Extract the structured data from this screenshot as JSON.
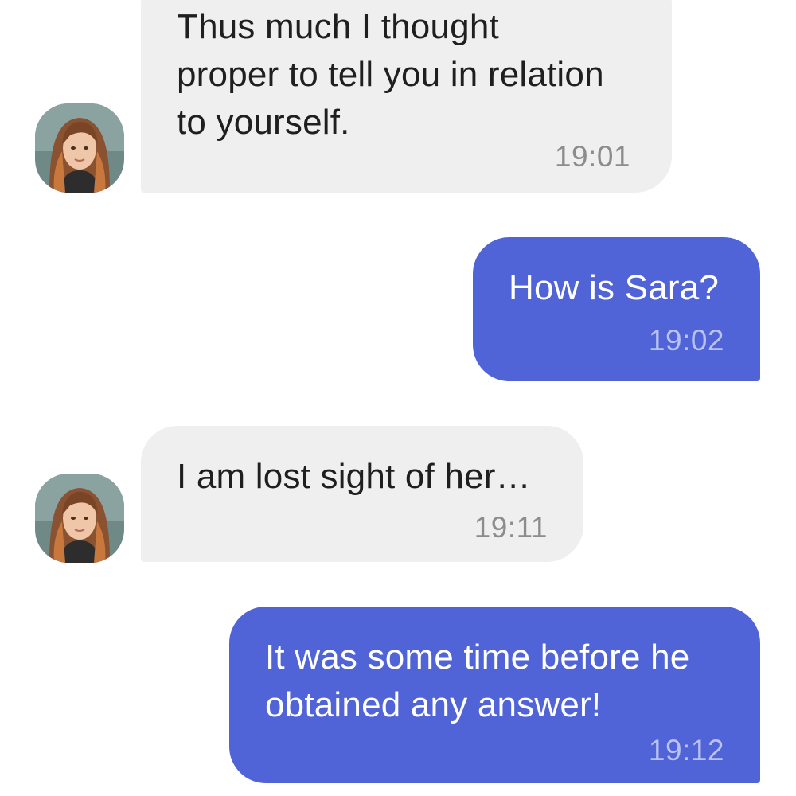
{
  "messages": [
    {
      "direction": "incoming",
      "text": "Thus much I thought\nproper to tell you in relation\nto yourself.",
      "time": "19:01",
      "avatar": "woman-portrait-avatar"
    },
    {
      "direction": "outgoing",
      "text": "How is Sara?",
      "time": "19:02"
    },
    {
      "direction": "incoming",
      "text": "I am lost sight of her…",
      "time": "19:11",
      "avatar": "woman-portrait-avatar"
    },
    {
      "direction": "outgoing",
      "text": "It was some time before he\nobtained any answer!",
      "time": "19:12"
    }
  ],
  "colors": {
    "incoming_bubble": "#efefef",
    "outgoing_bubble": "#5064d8",
    "incoming_time": "#8c8c8c",
    "outgoing_time": "#b9c2f3"
  }
}
